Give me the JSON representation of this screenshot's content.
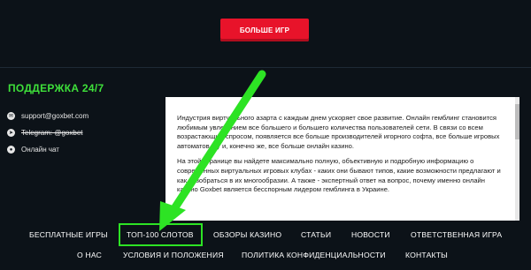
{
  "more_games_label": "БОЛЬШЕ ИГР",
  "support": {
    "title": "ПОДДЕРЖКА 24/7",
    "contacts": [
      {
        "icon": "email-icon",
        "label": "support@goxbet.com"
      },
      {
        "icon": "telegram-icon",
        "label": "Telegram: @goxbet"
      },
      {
        "icon": "chat-icon",
        "label": "Онлайн чат"
      }
    ]
  },
  "article": {
    "paragraphs": [
      "Индустрия виртуального азарта с каждым днем ускоряет свое развитие. Онлайн гемблинг становится любимым увлечением все большего и большего количества пользователей сети. В связи со всем возрастающим спросом, появляется все больше производителей игорного софта, все больше игровых автоматов, ну и, конечно же, все больше онлайн казино.",
      "На этой странице вы найдете максимально полную, объективную и подробную информацию о современных виртуальных игровых клубах - каких они бывают типов, какие возможности предлагают и как разобраться в их многообразии. А также - экспертный ответ на вопрос, почему именно онлайн казино Goxbet является бесспорным лидером гемблинга в Украине."
    ]
  },
  "footer": {
    "row1": [
      "БЕСПЛАТНЫЕ ИГРЫ",
      "ТОП-100 СЛОТОВ",
      "ОБЗОРЫ КАЗИНО",
      "СТАТЬИ",
      "НОВОСТИ",
      "ОТВЕТСТВЕННАЯ ИГРА"
    ],
    "row2": [
      "О НАС",
      "УСЛОВИЯ И ПОЛОЖЕНИЯ",
      "ПОЛИТИКА КОНФИДЕНЦИАЛЬНОСТИ",
      "КОНТАКТЫ"
    ]
  },
  "colors": {
    "background": "#0c1218",
    "accent_red": "#e8132a",
    "support_green": "#3ee03a",
    "annotation_green": "#2de324"
  }
}
